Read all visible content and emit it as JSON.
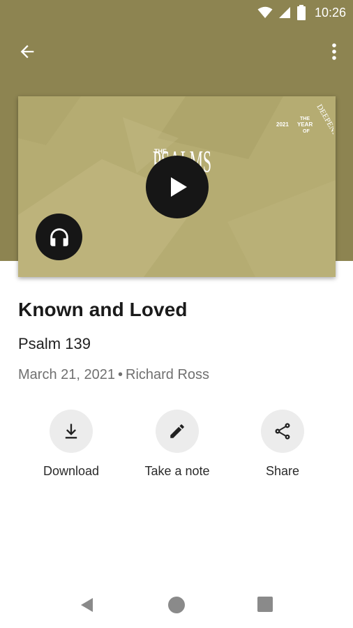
{
  "status_bar": {
    "time": "10:26",
    "icons": [
      "wifi-icon",
      "signal-icon",
      "battery-icon"
    ],
    "color": "#8d8451"
  },
  "app_bar": {
    "back_icon": "arrow-back-icon",
    "more_icon": "more-vert-icon",
    "color": "#8d8451"
  },
  "artwork": {
    "series_logo": {
      "small": "THE",
      "letters": "PSALMS"
    },
    "year_logo": {
      "year": "2021",
      "line1": "THE",
      "line2": "YEAR",
      "line3": "OF",
      "word": "DEEPENING"
    },
    "play_icon": "play-icon",
    "audio_icon": "headphones-icon",
    "background": "#b5ac72"
  },
  "sermon": {
    "title": "Known and Loved",
    "scripture": "Psalm 139",
    "date": "March 21, 2021",
    "separator": "•",
    "speaker": "Richard Ross"
  },
  "actions": [
    {
      "label": "Download",
      "icon": "download-icon"
    },
    {
      "label": "Take a note",
      "icon": "pencil-icon"
    },
    {
      "label": "Share",
      "icon": "share-icon"
    }
  ],
  "nav": {
    "back_icon": "nav-back-icon",
    "home_icon": "nav-home-icon",
    "recents_icon": "nav-recents-icon"
  }
}
